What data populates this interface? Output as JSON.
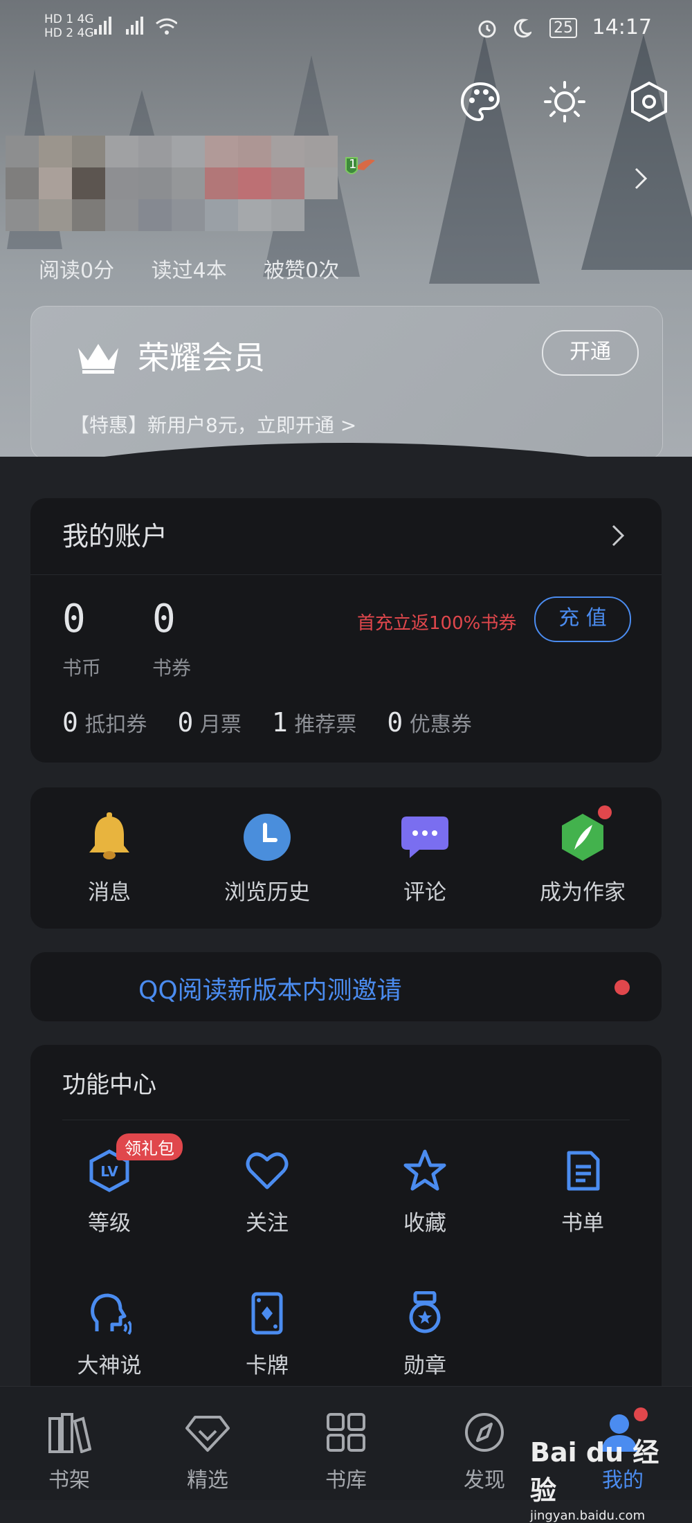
{
  "status_bar": {
    "left_top": "HD 1 4G",
    "left_bottom": "HD 2 4G",
    "battery": "25",
    "time": "14:17"
  },
  "profile": {
    "level_badge": "1",
    "stats": [
      "阅读0分",
      "读过4本",
      "被赞0次"
    ]
  },
  "vip": {
    "title": "荣耀会员",
    "promo": "【特惠】新用户8元，立即开通 >",
    "button": "开通"
  },
  "account": {
    "title": "我的账户",
    "coins_value": "0",
    "coins_label": "书币",
    "vouchers_value": "0",
    "vouchers_label": "书券",
    "recharge_promo": "首充立返100%书券",
    "recharge_button": "充 值",
    "tickets": [
      {
        "value": "0",
        "label": "抵扣券"
      },
      {
        "value": "0",
        "label": "月票"
      },
      {
        "value": "1",
        "label": "推荐票"
      },
      {
        "value": "0",
        "label": "优惠券"
      }
    ]
  },
  "quick": [
    {
      "label": "消息",
      "icon": "bell-icon"
    },
    {
      "label": "浏览历史",
      "icon": "clock-icon"
    },
    {
      "label": "评论",
      "icon": "chat-bubble-icon"
    },
    {
      "label": "成为作家",
      "icon": "quill-icon"
    }
  ],
  "invite": {
    "text": "QQ阅读新版本内测邀请"
  },
  "features": {
    "title": "功能中心",
    "gift_badge": "领礼包",
    "items": [
      {
        "label": "等级",
        "icon": "level-icon"
      },
      {
        "label": "关注",
        "icon": "heart-icon"
      },
      {
        "label": "收藏",
        "icon": "star-icon"
      },
      {
        "label": "书单",
        "icon": "booklist-icon"
      },
      {
        "label": "大神说",
        "icon": "speaking-head-icon"
      },
      {
        "label": "卡牌",
        "icon": "card-icon"
      },
      {
        "label": "勋章",
        "icon": "medal-icon"
      }
    ]
  },
  "nav": [
    {
      "label": "书架",
      "icon": "bookshelf-icon"
    },
    {
      "label": "精选",
      "icon": "diamond-icon"
    },
    {
      "label": "书库",
      "icon": "grid-icon"
    },
    {
      "label": "发现",
      "icon": "compass-icon"
    },
    {
      "label": "我的",
      "icon": "user-icon"
    }
  ],
  "watermark": {
    "text": "Bai du 经验",
    "sub": "jingyan.baidu.com"
  },
  "colors": {
    "accent_blue": "#4b8cf0",
    "promo_red": "#e0474c",
    "card_bg": "#16171a",
    "page_bg": "#202226"
  }
}
